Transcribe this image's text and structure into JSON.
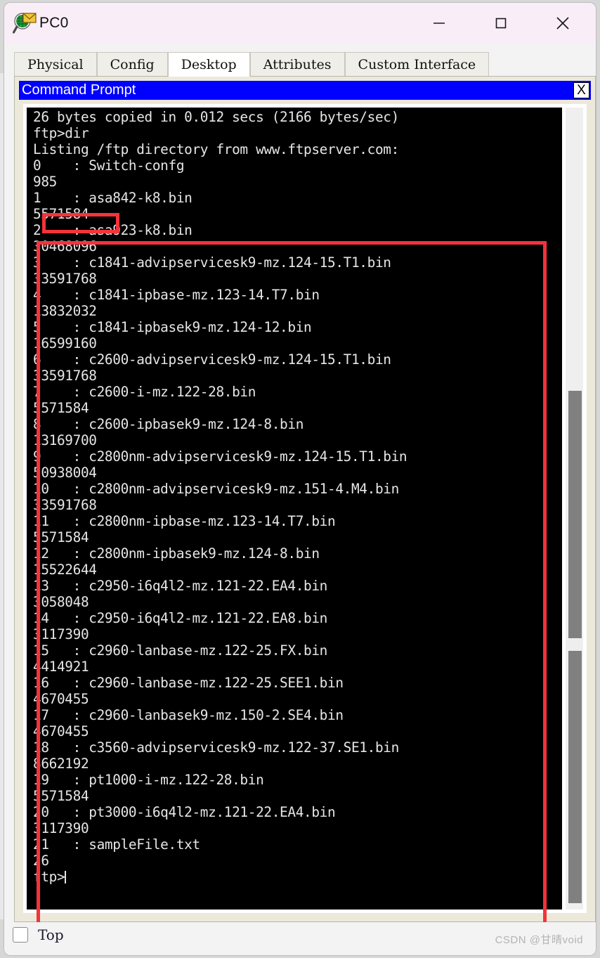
{
  "window": {
    "title": "PC0",
    "icon": "packet-tracer-pc-icon",
    "controls": {
      "minimize": "minimize-icon",
      "maximize": "maximize-icon",
      "close": "close-icon"
    }
  },
  "tabs": [
    {
      "label": "Physical",
      "active": false
    },
    {
      "label": "Config",
      "active": false
    },
    {
      "label": "Desktop",
      "active": true
    },
    {
      "label": "Attributes",
      "active": false
    },
    {
      "label": "Custom Interface",
      "active": false
    }
  ],
  "cmd_window": {
    "title": "Command Prompt",
    "close_label": "X"
  },
  "terminal": {
    "lines": [
      "26 bytes copied in 0.012 secs (2166 bytes/sec)",
      "ftp>dir",
      "Listing /ftp directory from www.ftpserver.com:",
      "0    : Switch-confg",
      "985",
      "1    : asa842-k8.bin",
      "5571584",
      "2    : asa923-k8.bin",
      "30468096",
      "3    : c1841-advipservicesk9-mz.124-15.T1.bin",
      "33591768",
      "4    : c1841-ipbase-mz.123-14.T7.bin",
      "13832032",
      "5    : c1841-ipbasek9-mz.124-12.bin",
      "16599160",
      "6    : c2600-advipservicesk9-mz.124-15.T1.bin",
      "33591768",
      "7    : c2600-i-mz.122-28.bin",
      "5571584",
      "8    : c2600-ipbasek9-mz.124-8.bin",
      "13169700",
      "9    : c2800nm-advipservicesk9-mz.124-15.T1.bin",
      "50938004",
      "10   : c2800nm-advipservicesk9-mz.151-4.M4.bin",
      "33591768",
      "11   : c2800nm-ipbase-mz.123-14.T7.bin",
      "5571584",
      "12   : c2800nm-ipbasek9-mz.124-8.bin",
      "15522644",
      "13   : c2950-i6q4l2-mz.121-22.EA4.bin",
      "3058048",
      "14   : c2950-i6q4l2-mz.121-22.EA8.bin",
      "3117390",
      "15   : c2960-lanbase-mz.122-25.FX.bin",
      "4414921",
      "16   : c2960-lanbase-mz.122-25.SEE1.bin",
      "4670455",
      "17   : c2960-lanbasek9-mz.150-2.SE4.bin",
      "4670455",
      "18   : c3560-advipservicesk9-mz.122-37.SE1.bin",
      "8662192",
      "19   : pt1000-i-mz.122-28.bin",
      "5571584",
      "20   : pt3000-i6q4l2-mz.121-22.EA4.bin",
      "3117390",
      "21   : sampleFile.txt",
      "26"
    ],
    "prompt": "ftp>"
  },
  "ftp_listing": {
    "header": "Listing /ftp directory from www.ftpserver.com:",
    "transfer_status": "26 bytes copied in 0.012 secs (2166 bytes/sec)",
    "command": "ftp>dir",
    "files": [
      {
        "index": "0",
        "name": "Switch-confg",
        "size": "985"
      },
      {
        "index": "1",
        "name": "asa842-k8.bin",
        "size": "5571584"
      },
      {
        "index": "2",
        "name": "asa923-k8.bin",
        "size": "30468096"
      },
      {
        "index": "3",
        "name": "c1841-advipservicesk9-mz.124-15.T1.bin",
        "size": "33591768"
      },
      {
        "index": "4",
        "name": "c1841-ipbase-mz.123-14.T7.bin",
        "size": "13832032"
      },
      {
        "index": "5",
        "name": "c1841-ipbasek9-mz.124-12.bin",
        "size": "16599160"
      },
      {
        "index": "6",
        "name": "c2600-advipservicesk9-mz.124-15.T1.bin",
        "size": "33591768"
      },
      {
        "index": "7",
        "name": "c2600-i-mz.122-28.bin",
        "size": "5571584"
      },
      {
        "index": "8",
        "name": "c2600-ipbasek9-mz.124-8.bin",
        "size": "13169700"
      },
      {
        "index": "9",
        "name": "c2800nm-advipservicesk9-mz.124-15.T1.bin",
        "size": "50938004"
      },
      {
        "index": "10",
        "name": "c2800nm-advipservicesk9-mz.151-4.M4.bin",
        "size": "33591768"
      },
      {
        "index": "11",
        "name": "c2800nm-ipbase-mz.123-14.T7.bin",
        "size": "5571584"
      },
      {
        "index": "12",
        "name": "c2800nm-ipbasek9-mz.124-8.bin",
        "size": "15522644"
      },
      {
        "index": "13",
        "name": "c2950-i6q4l2-mz.121-22.EA4.bin",
        "size": "3058048"
      },
      {
        "index": "14",
        "name": "c2950-i6q4l2-mz.121-22.EA8.bin",
        "size": "3117390"
      },
      {
        "index": "15",
        "name": "c2960-lanbase-mz.122-25.FX.bin",
        "size": "4414921"
      },
      {
        "index": "16",
        "name": "c2960-lanbase-mz.122-25.SEE1.bin",
        "size": "4670455"
      },
      {
        "index": "17",
        "name": "c2960-lanbasek9-mz.150-2.SE4.bin",
        "size": "4670455"
      },
      {
        "index": "18",
        "name": "c3560-advipservicesk9-mz.122-37.SE1.bin",
        "size": "8662192"
      },
      {
        "index": "19",
        "name": "pt1000-i-mz.122-28.bin",
        "size": "5571584"
      },
      {
        "index": "20",
        "name": "pt3000-i6q4l2-mz.121-22.EA4.bin",
        "size": "3117390"
      },
      {
        "index": "21",
        "name": "sampleFile.txt",
        "size": "26"
      }
    ]
  },
  "footer": {
    "top_label": "Top",
    "top_checked": false,
    "watermark": "CSDN @甘晴void"
  },
  "colors": {
    "cmd_titlebar": "#0000ff",
    "terminal_bg": "#000000",
    "terminal_fg": "#e6e6e6",
    "annotation_red": "#f4333a",
    "panel_beige": "#ece9db"
  }
}
